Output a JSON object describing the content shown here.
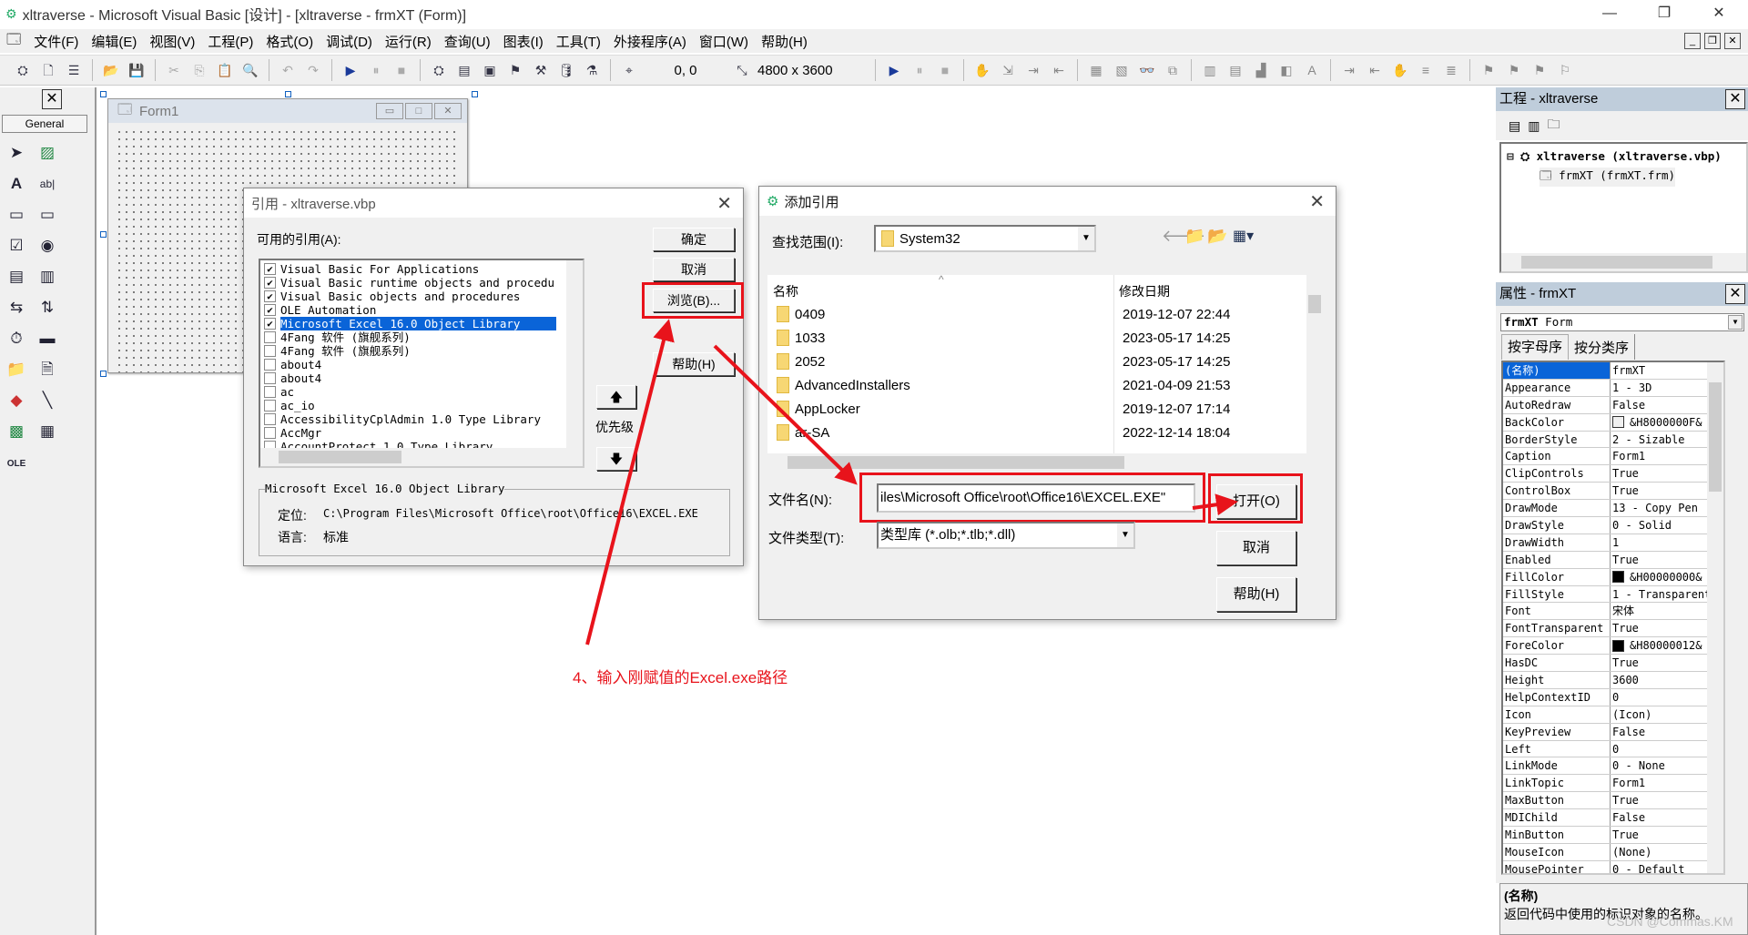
{
  "window": {
    "title": "xltraverse - Microsoft Visual Basic [设计] - [xltraverse - frmXT (Form)]"
  },
  "menu": [
    "文件(F)",
    "编辑(E)",
    "视图(V)",
    "工程(P)",
    "格式(O)",
    "调试(D)",
    "运行(R)",
    "查询(U)",
    "图表(I)",
    "工具(T)",
    "外接程序(A)",
    "窗口(W)",
    "帮助(H)"
  ],
  "toolbar": {
    "position": "0, 0",
    "size": "4800 x 3600"
  },
  "toolbox": {
    "tab": "General"
  },
  "form": {
    "caption": "Form1"
  },
  "references_dialog": {
    "title": "引用 - xltraverse.vbp",
    "available_label": "可用的引用(A):",
    "items": [
      {
        "label": "Visual Basic For Applications",
        "checked": true
      },
      {
        "label": "Visual Basic runtime objects and procedure",
        "checked": true
      },
      {
        "label": "Visual Basic objects and procedures",
        "checked": true
      },
      {
        "label": "OLE Automation",
        "checked": true
      },
      {
        "label": "Microsoft Excel 16.0 Object Library",
        "checked": true,
        "selected": true
      },
      {
        "label": "4Fang 软件 (旗舰系列)",
        "checked": false
      },
      {
        "label": "4Fang 软件 (旗舰系列)",
        "checked": false
      },
      {
        "label": "about4",
        "checked": false
      },
      {
        "label": "about4",
        "checked": false
      },
      {
        "label": "ac",
        "checked": false
      },
      {
        "label": "ac_io",
        "checked": false
      },
      {
        "label": "AccessibilityCplAdmin 1.0 Type Library",
        "checked": false
      },
      {
        "label": "AccMgr",
        "checked": false
      },
      {
        "label": "AccountProtect 1.0 Type Library",
        "checked": false
      }
    ],
    "ok": "确定",
    "cancel": "取消",
    "browse": "浏览(B)...",
    "help": "帮助(H)",
    "priority": "优先级",
    "info": {
      "group": "Microsoft Excel 16.0 Object Library",
      "location_label": "定位:",
      "location": "C:\\Program Files\\Microsoft Office\\root\\Office16\\EXCEL.EXE",
      "language_label": "语言:",
      "language": "标准"
    }
  },
  "add_reference_dialog": {
    "title": "添加引用",
    "look_in_label": "查找范围(I):",
    "look_in": "System32",
    "columns": {
      "name": "名称",
      "modified": "修改日期"
    },
    "files": [
      {
        "name": "0409",
        "date": "2019-12-07 22:44"
      },
      {
        "name": "1033",
        "date": "2023-05-17 14:25"
      },
      {
        "name": "2052",
        "date": "2023-05-17 14:25"
      },
      {
        "name": "AdvancedInstallers",
        "date": "2021-04-09 21:53"
      },
      {
        "name": "AppLocker",
        "date": "2019-12-07 17:14"
      },
      {
        "name": "ar-SA",
        "date": "2022-12-14 18:04"
      }
    ],
    "filename_label": "文件名(N):",
    "filename": "iles\\Microsoft Office\\root\\Office16\\EXCEL.EXE\"",
    "filetype_label": "文件类型(T):",
    "filetype": "类型库 (*.olb;*.tlb;*.dll)",
    "open": "打开(O)",
    "cancel": "取消",
    "help": "帮助(H)"
  },
  "annotation": {
    "text": "4、输入刚赋值的Excel.exe路径",
    "color": "#e8131b"
  },
  "project_panel": {
    "title": "工程 - xltraverse",
    "root": "xltraverse (xltraverse.vbp)",
    "child": "frmXT (frmXT.frm)"
  },
  "properties_panel": {
    "title": "属性 - frmXT",
    "object_bold": "frmXT",
    "object_type": "Form",
    "tabs": [
      "按字母序",
      "按分类序"
    ],
    "rows": [
      {
        "name": "(名称)",
        "value": "frmXT"
      },
      {
        "name": "Appearance",
        "value": "1 - 3D"
      },
      {
        "name": "AutoRedraw",
        "value": "False"
      },
      {
        "name": "BackColor",
        "value": "&H8000000F&",
        "swatch": "#f0f0f0"
      },
      {
        "name": "BorderStyle",
        "value": "2 - Sizable"
      },
      {
        "name": "Caption",
        "value": "Form1"
      },
      {
        "name": "ClipControls",
        "value": "True"
      },
      {
        "name": "ControlBox",
        "value": "True"
      },
      {
        "name": "DrawMode",
        "value": "13 - Copy Pen"
      },
      {
        "name": "DrawStyle",
        "value": "0 - Solid"
      },
      {
        "name": "DrawWidth",
        "value": "1"
      },
      {
        "name": "Enabled",
        "value": "True"
      },
      {
        "name": "FillColor",
        "value": "&H00000000&",
        "swatch": "#000000"
      },
      {
        "name": "FillStyle",
        "value": "1 - Transparent"
      },
      {
        "name": "Font",
        "value": "宋体"
      },
      {
        "name": "FontTransparent",
        "value": "True"
      },
      {
        "name": "ForeColor",
        "value": "&H80000012&",
        "swatch": "#000000"
      },
      {
        "name": "HasDC",
        "value": "True"
      },
      {
        "name": "Height",
        "value": "3600"
      },
      {
        "name": "HelpContextID",
        "value": "0"
      },
      {
        "name": "Icon",
        "value": "(Icon)"
      },
      {
        "name": "KeyPreview",
        "value": "False"
      },
      {
        "name": "Left",
        "value": "0"
      },
      {
        "name": "LinkMode",
        "value": "0 - None"
      },
      {
        "name": "LinkTopic",
        "value": "Form1"
      },
      {
        "name": "MaxButton",
        "value": "True"
      },
      {
        "name": "MDIChild",
        "value": "False"
      },
      {
        "name": "MinButton",
        "value": "True"
      },
      {
        "name": "MouseIcon",
        "value": "(None)"
      },
      {
        "name": "MousePointer",
        "value": "0 - Default"
      }
    ],
    "desc_title": "(名称)",
    "desc_text": "返回代码中使用的标识对象的名称。"
  },
  "watermark": "CSDN @Commas.KM"
}
